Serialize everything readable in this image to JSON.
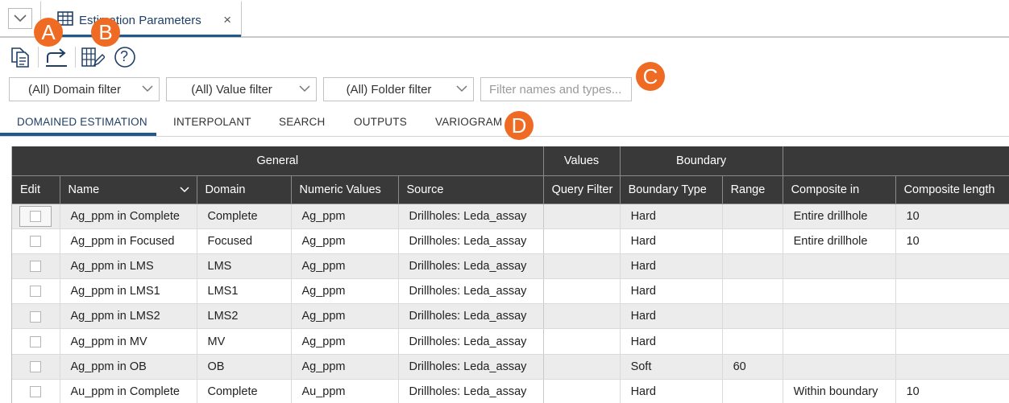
{
  "doc_tab": {
    "title": "Estimation Parameters",
    "close_glyph": "×"
  },
  "toolbar": {
    "copy_icon": "copy-document-icon",
    "export_icon": "export-arrow-icon",
    "edit_columns_icon": "edit-columns-icon",
    "help_glyph": "?"
  },
  "filters": {
    "domain": "(All) Domain filter",
    "value": "(All) Value filter",
    "folder": "(All) Folder filter",
    "search_placeholder": "Filter names and types..."
  },
  "subtabs": [
    "DOMAINED ESTIMATION",
    "INTERPOLANT",
    "SEARCH",
    "OUTPUTS",
    "VARIOGRAM"
  ],
  "callouts": {
    "a": "A",
    "b": "B",
    "c": "C",
    "d": "D"
  },
  "table": {
    "groups": {
      "general": "General",
      "values": "Values",
      "boundary": "Boundary"
    },
    "columns": [
      "Edit",
      "Name",
      "Domain",
      "Numeric Values",
      "Source",
      "Query Filter",
      "Boundary Type",
      "Range",
      "Composite in",
      "Composite length"
    ],
    "rows": [
      {
        "name": "Ag_ppm in Complete",
        "domain": "Complete",
        "values": "Ag_ppm",
        "source": "Drillholes: Leda_assay",
        "query": "",
        "btype": "Hard",
        "range": "",
        "comp_in": "Entire drillhole",
        "comp_len": "10"
      },
      {
        "name": "Ag_ppm in Focused",
        "domain": "Focused",
        "values": "Ag_ppm",
        "source": "Drillholes: Leda_assay",
        "query": "",
        "btype": "Hard",
        "range": "",
        "comp_in": "Entire drillhole",
        "comp_len": "10"
      },
      {
        "name": "Ag_ppm in LMS",
        "domain": "LMS",
        "values": "Ag_ppm",
        "source": "Drillholes: Leda_assay",
        "query": "",
        "btype": "Hard",
        "range": "",
        "comp_in": "",
        "comp_len": ""
      },
      {
        "name": "Ag_ppm in LMS1",
        "domain": "LMS1",
        "values": "Ag_ppm",
        "source": "Drillholes: Leda_assay",
        "query": "",
        "btype": "Hard",
        "range": "",
        "comp_in": "",
        "comp_len": ""
      },
      {
        "name": "Ag_ppm in LMS2",
        "domain": "LMS2",
        "values": "Ag_ppm",
        "source": "Drillholes: Leda_assay",
        "query": "",
        "btype": "Hard",
        "range": "",
        "comp_in": "",
        "comp_len": ""
      },
      {
        "name": "Ag_ppm in MV",
        "domain": "MV",
        "values": "Ag_ppm",
        "source": "Drillholes: Leda_assay",
        "query": "",
        "btype": "Hard",
        "range": "",
        "comp_in": "",
        "comp_len": ""
      },
      {
        "name": "Ag_ppm in OB",
        "domain": "OB",
        "values": "Ag_ppm",
        "source": "Drillholes: Leda_assay",
        "query": "",
        "btype": "Soft",
        "range": "60",
        "comp_in": "",
        "comp_len": ""
      },
      {
        "name": "Au_ppm in Complete",
        "domain": "Complete",
        "values": "Au_ppm",
        "source": "Drillholes: Leda_assay",
        "query": "",
        "btype": "Hard",
        "range": "",
        "comp_in": "Within boundary",
        "comp_len": "10"
      }
    ]
  },
  "colors": {
    "accent": "#1e5a8e",
    "header_bg": "#393939",
    "callout": "#ef6a22",
    "row_alt": "#ececec"
  }
}
